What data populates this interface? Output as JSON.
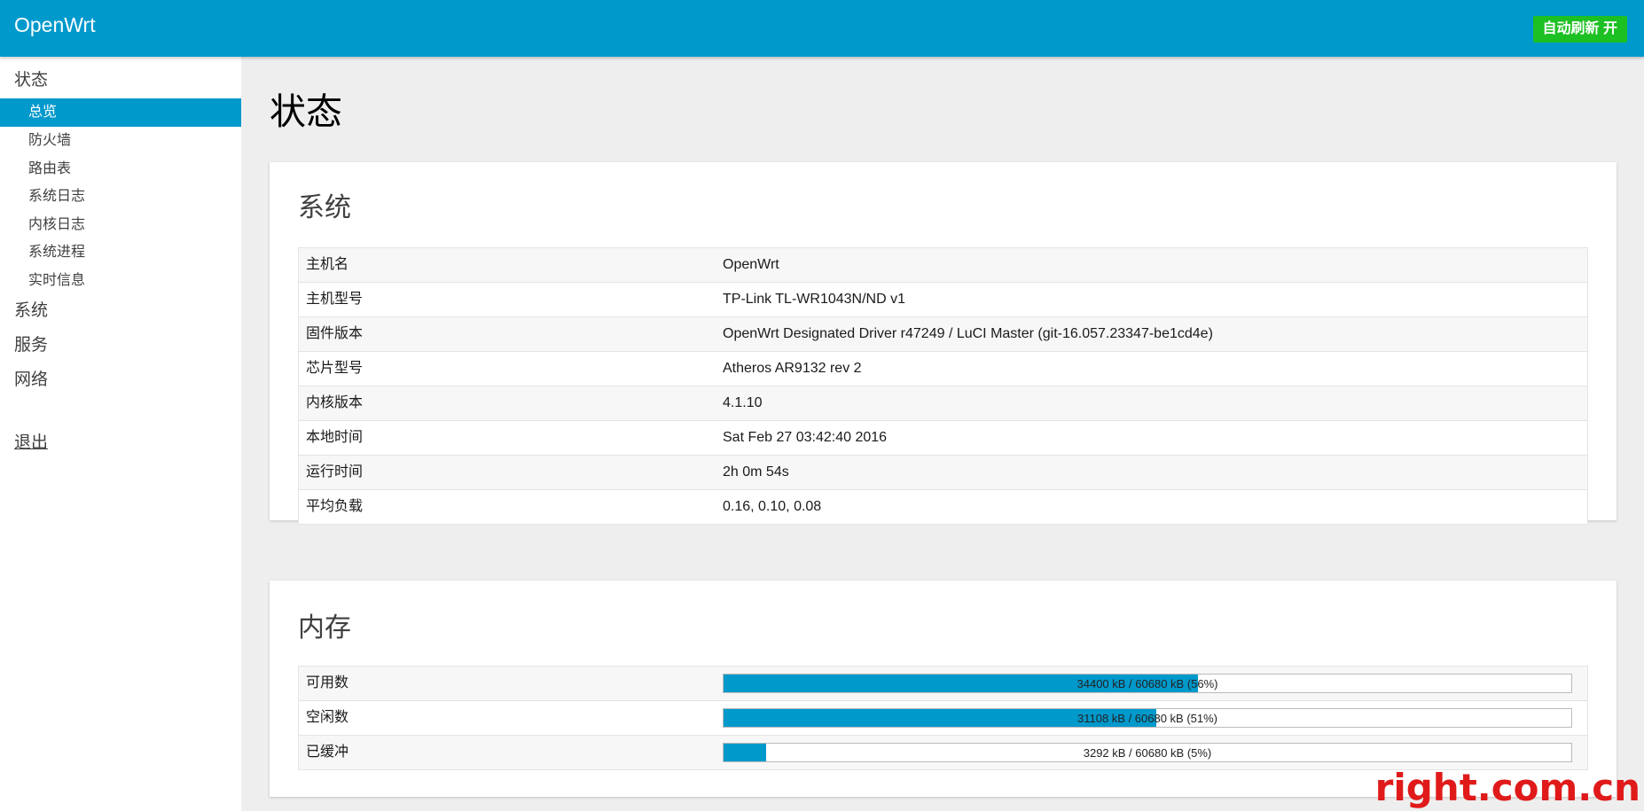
{
  "header": {
    "brand": "OpenWrt",
    "auto_refresh_label": "自动刷新 开"
  },
  "sidebar": {
    "groups": [
      {
        "label": "状态"
      },
      {
        "label": "系统"
      },
      {
        "label": "服务"
      },
      {
        "label": "网络"
      }
    ],
    "sub_items": [
      "总览",
      "防火墙",
      "路由表",
      "系统日志",
      "内核日志",
      "系统进程",
      "实时信息"
    ],
    "active_sub": "总览",
    "logout": "退出"
  },
  "page": {
    "title": "状态"
  },
  "system": {
    "title": "系统",
    "rows": [
      {
        "label": "主机名",
        "value": "OpenWrt"
      },
      {
        "label": "主机型号",
        "value": "TP-Link TL-WR1043N/ND v1"
      },
      {
        "label": "固件版本",
        "value": "OpenWrt Designated Driver r47249 / LuCI Master (git-16.057.23347-be1cd4e)"
      },
      {
        "label": "芯片型号",
        "value": "Atheros AR9132 rev 2"
      },
      {
        "label": "内核版本",
        "value": "4.1.10"
      },
      {
        "label": "本地时间",
        "value": "Sat Feb 27 03:42:40 2016"
      },
      {
        "label": "运行时间",
        "value": "2h 0m 54s"
      },
      {
        "label": "平均负载",
        "value": "0.16, 0.10, 0.08"
      }
    ]
  },
  "memory": {
    "title": "内存",
    "rows": [
      {
        "label": "可用数",
        "text": "34400 kB / 60680 kB (56%)",
        "fraction": 0.56
      },
      {
        "label": "空闲数",
        "text": "31108 kB / 60680 kB (51%)",
        "fraction": 0.51
      },
      {
        "label": "已缓冲",
        "text": "3292 kB / 60680 kB (5%)",
        "fraction": 0.05
      }
    ]
  },
  "watermark": "right.com.cn",
  "colors": {
    "accent": "#0099cc",
    "refresh_button": "#1dc022",
    "watermark": "#e01a1a"
  }
}
